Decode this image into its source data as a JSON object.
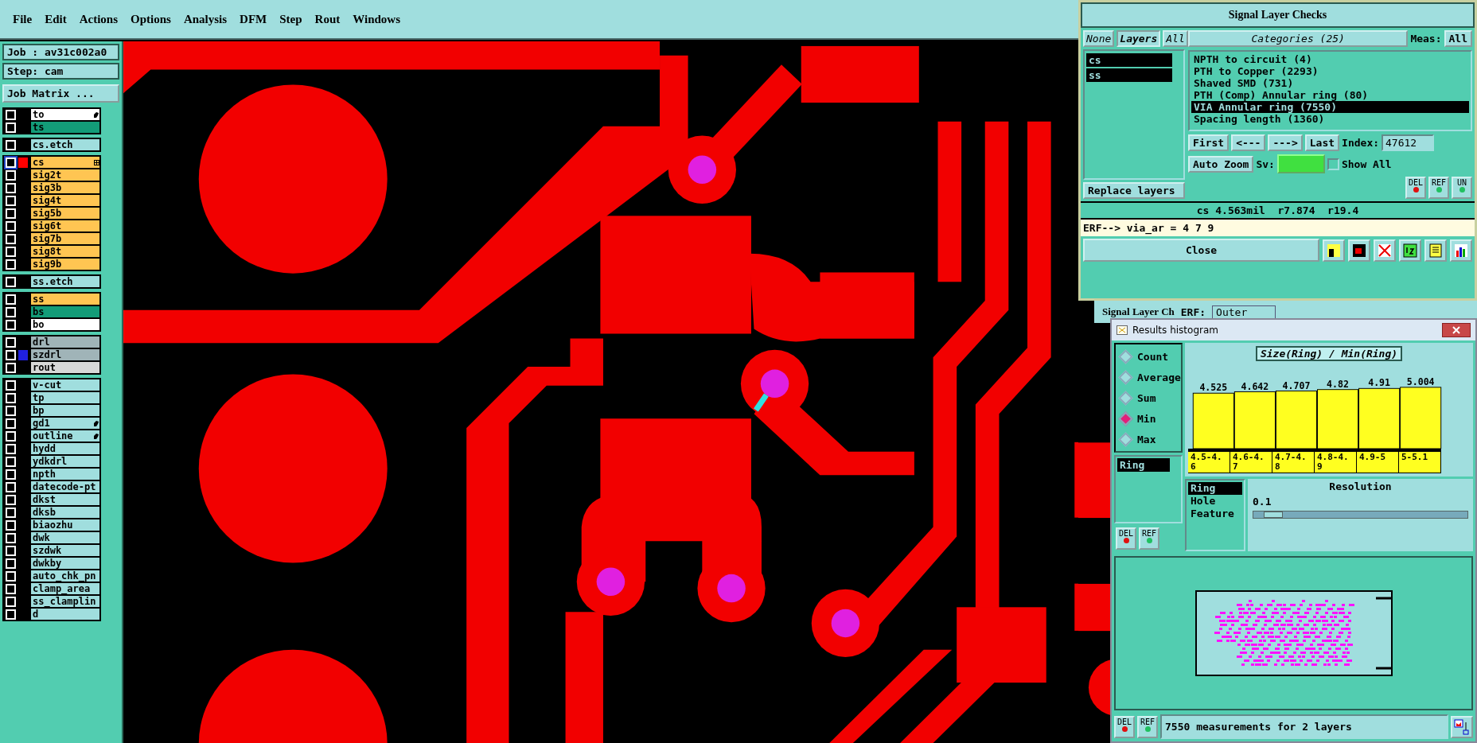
{
  "menu": [
    {
      "label": "File"
    },
    {
      "label": "Edit"
    },
    {
      "label": "Actions"
    },
    {
      "label": "Options"
    },
    {
      "label": "Analysis"
    },
    {
      "label": "DFM"
    },
    {
      "label": "Step"
    },
    {
      "label": "Rout"
    },
    {
      "label": "Windows"
    }
  ],
  "left_panel": {
    "job": "Job : av31c002a0",
    "step": "Step: cam",
    "job_matrix_button": "Job Matrix ...",
    "layer_groups": [
      [
        {
          "name": "to",
          "color": "#ffffff",
          "checked": false,
          "pinned": true
        },
        {
          "name": "ts",
          "color": "#139c78",
          "checked": false
        }
      ],
      [
        {
          "name": "cs.etch",
          "color": "#a0dede",
          "checked": false
        }
      ],
      [
        {
          "name": "cs",
          "color": "#ffc552",
          "checked": false,
          "swatch": {
            "color": "#ff0000"
          },
          "expandable": true,
          "focused": true
        },
        {
          "name": "sig2t",
          "color": "#ffc552",
          "checked": false
        },
        {
          "name": "sig3b",
          "color": "#ffc552",
          "checked": false
        },
        {
          "name": "sig4t",
          "color": "#ffc552",
          "checked": false
        },
        {
          "name": "sig5b",
          "color": "#ffc552",
          "checked": false
        },
        {
          "name": "sig6t",
          "color": "#ffc552",
          "checked": false
        },
        {
          "name": "sig7b",
          "color": "#ffc552",
          "checked": false
        },
        {
          "name": "sig8t",
          "color": "#ffc552",
          "checked": false
        },
        {
          "name": "sig9b",
          "color": "#ffc552",
          "checked": false
        }
      ],
      [
        {
          "name": "ss.etch",
          "color": "#a0dede",
          "checked": false
        }
      ],
      [
        {
          "name": "ss",
          "color": "#ffc552",
          "checked": false
        },
        {
          "name": "bs",
          "color": "#139c78",
          "checked": false
        },
        {
          "name": "bo",
          "color": "#ffffff",
          "checked": false
        }
      ],
      [
        {
          "name": "drl",
          "color": "#a0b4b8",
          "checked": false
        },
        {
          "name": "szdrl",
          "color": "#a0b4b8",
          "checked": false,
          "swatch": {
            "color": "#2020e0"
          }
        },
        {
          "name": "rout",
          "color": "#d8d8d8",
          "checked": false
        }
      ],
      [
        {
          "name": "v-cut",
          "color": "#a0dede",
          "checked": false
        },
        {
          "name": "tp",
          "color": "#a0dede",
          "checked": false
        },
        {
          "name": "bp",
          "color": "#a0dede",
          "checked": false
        },
        {
          "name": "gd1",
          "color": "#a0dede",
          "checked": false,
          "pinned": true
        },
        {
          "name": "outline",
          "color": "#a0dede",
          "checked": false,
          "pinned": true
        },
        {
          "name": "hydd",
          "color": "#a0dede",
          "checked": false
        },
        {
          "name": "ydkdrl",
          "color": "#a0dede",
          "checked": false
        },
        {
          "name": "npth",
          "color": "#a0dede",
          "checked": false
        },
        {
          "name": "datecode-pt",
          "color": "#a0dede",
          "checked": false
        },
        {
          "name": "dkst",
          "color": "#a0dede",
          "checked": false
        },
        {
          "name": "dksb",
          "color": "#a0dede",
          "checked": false
        },
        {
          "name": "biaozhu",
          "color": "#a0dede",
          "checked": false
        },
        {
          "name": "dwk",
          "color": "#a0dede",
          "checked": false
        },
        {
          "name": "szdwk",
          "color": "#a0dede",
          "checked": false
        },
        {
          "name": "dwkby",
          "color": "#a0dede",
          "checked": false
        },
        {
          "name": "auto_chk_pn",
          "color": "#a0dede",
          "checked": false
        },
        {
          "name": "clamp_area",
          "color": "#a0dede",
          "checked": false
        },
        {
          "name": "ss_clamplin",
          "color": "#a0dede",
          "checked": false
        },
        {
          "name": "d",
          "color": "#a0dede",
          "checked": false
        }
      ]
    ]
  },
  "signal_layer_checks": {
    "title": "Signal Layer Checks",
    "layer_tabs": [
      {
        "label": "None",
        "selected": false
      },
      {
        "label": "Layers",
        "selected": true
      },
      {
        "label": "All",
        "selected": false
      }
    ],
    "layers": [
      {
        "name": "cs",
        "selected": true
      },
      {
        "name": "ss",
        "selected": true
      }
    ],
    "replace_layers": "Replace layers",
    "categories_header": "Categories (25)",
    "meas_label": "Meas:",
    "meas_value": "All",
    "categories": [
      {
        "label": "NPTH to circuit (4)",
        "selected": false
      },
      {
        "label": "PTH to Copper (2293)",
        "selected": false
      },
      {
        "label": "Shaved SMD (731)",
        "selected": false
      },
      {
        "label": "PTH (Comp) Annular ring (80)",
        "selected": false
      },
      {
        "label": "VIA Annular ring (7550)",
        "selected": true
      },
      {
        "label": "Spacing length (1360)",
        "selected": false
      }
    ],
    "nav_buttons": [
      "First",
      "<---",
      "--->",
      "Last"
    ],
    "index_label": "Index:",
    "index_value": "47612",
    "auto_zoom": "Auto Zoom",
    "sv_label": "Sv:",
    "show_all": {
      "label": "Show All",
      "checked": false
    },
    "action_buttons": [
      "DEL",
      "REF",
      "UN"
    ],
    "status": "cs 4.563mil  r7.874  r19.4",
    "erf_line": "ERF--> via_ar = 4 7 9",
    "close": "Close"
  },
  "background_window": {
    "title": "Signal Layer Ch",
    "erf_label": "ERF:",
    "erf_value": "Outer"
  },
  "results_histogram": {
    "title": "Results histogram",
    "modes": [
      {
        "label": "Count",
        "selected": false
      },
      {
        "label": "Average",
        "selected": false
      },
      {
        "label": "Sum",
        "selected": false
      },
      {
        "label": "Min",
        "selected": true
      },
      {
        "label": "Max",
        "selected": false
      }
    ],
    "attributes": [
      {
        "label": "Ring",
        "selected": true
      }
    ],
    "chart_data": {
      "type": "bar",
      "title": "Size(Ring) / Min(Ring)",
      "categories": [
        "4.5-4.6",
        "4.6-4.7",
        "4.7-4.8",
        "4.8-4.9",
        "4.9-5",
        "5-5.1"
      ],
      "series": [
        {
          "color": "#ffff20",
          "values": [
            4.525,
            4.642,
            4.707,
            4.82,
            4.91,
            5.004
          ]
        }
      ],
      "data_labels": true
    },
    "group_by": [
      {
        "label": "Ring",
        "selected": true
      },
      {
        "label": "Hole",
        "selected": false
      },
      {
        "label": "Feature",
        "selected": false
      }
    ],
    "resolution_label": "Resolution",
    "resolution_value": "0.1",
    "resolution_slider": {
      "level": 0.05
    },
    "left_buttons": [
      "DEL",
      "REF"
    ],
    "footer_buttons": [
      "DEL",
      "REF"
    ],
    "summary": "7550 measurements for 2 layers"
  }
}
